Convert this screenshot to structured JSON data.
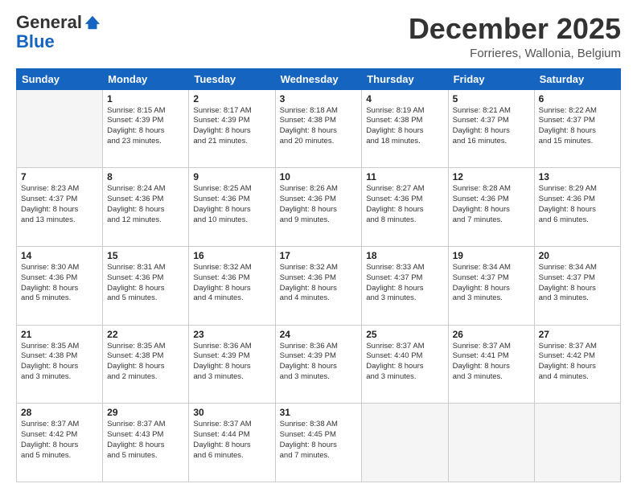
{
  "header": {
    "logo_general": "General",
    "logo_blue": "Blue",
    "month_title": "December 2025",
    "location": "Forrieres, Wallonia, Belgium"
  },
  "calendar": {
    "days_of_week": [
      "Sunday",
      "Monday",
      "Tuesday",
      "Wednesday",
      "Thursday",
      "Friday",
      "Saturday"
    ],
    "weeks": [
      [
        {
          "day": "",
          "info": ""
        },
        {
          "day": "1",
          "info": "Sunrise: 8:15 AM\nSunset: 4:39 PM\nDaylight: 8 hours\nand 23 minutes."
        },
        {
          "day": "2",
          "info": "Sunrise: 8:17 AM\nSunset: 4:39 PM\nDaylight: 8 hours\nand 21 minutes."
        },
        {
          "day": "3",
          "info": "Sunrise: 8:18 AM\nSunset: 4:38 PM\nDaylight: 8 hours\nand 20 minutes."
        },
        {
          "day": "4",
          "info": "Sunrise: 8:19 AM\nSunset: 4:38 PM\nDaylight: 8 hours\nand 18 minutes."
        },
        {
          "day": "5",
          "info": "Sunrise: 8:21 AM\nSunset: 4:37 PM\nDaylight: 8 hours\nand 16 minutes."
        },
        {
          "day": "6",
          "info": "Sunrise: 8:22 AM\nSunset: 4:37 PM\nDaylight: 8 hours\nand 15 minutes."
        }
      ],
      [
        {
          "day": "7",
          "info": "Sunrise: 8:23 AM\nSunset: 4:37 PM\nDaylight: 8 hours\nand 13 minutes."
        },
        {
          "day": "8",
          "info": "Sunrise: 8:24 AM\nSunset: 4:36 PM\nDaylight: 8 hours\nand 12 minutes."
        },
        {
          "day": "9",
          "info": "Sunrise: 8:25 AM\nSunset: 4:36 PM\nDaylight: 8 hours\nand 10 minutes."
        },
        {
          "day": "10",
          "info": "Sunrise: 8:26 AM\nSunset: 4:36 PM\nDaylight: 8 hours\nand 9 minutes."
        },
        {
          "day": "11",
          "info": "Sunrise: 8:27 AM\nSunset: 4:36 PM\nDaylight: 8 hours\nand 8 minutes."
        },
        {
          "day": "12",
          "info": "Sunrise: 8:28 AM\nSunset: 4:36 PM\nDaylight: 8 hours\nand 7 minutes."
        },
        {
          "day": "13",
          "info": "Sunrise: 8:29 AM\nSunset: 4:36 PM\nDaylight: 8 hours\nand 6 minutes."
        }
      ],
      [
        {
          "day": "14",
          "info": "Sunrise: 8:30 AM\nSunset: 4:36 PM\nDaylight: 8 hours\nand 5 minutes."
        },
        {
          "day": "15",
          "info": "Sunrise: 8:31 AM\nSunset: 4:36 PM\nDaylight: 8 hours\nand 5 minutes."
        },
        {
          "day": "16",
          "info": "Sunrise: 8:32 AM\nSunset: 4:36 PM\nDaylight: 8 hours\nand 4 minutes."
        },
        {
          "day": "17",
          "info": "Sunrise: 8:32 AM\nSunset: 4:36 PM\nDaylight: 8 hours\nand 4 minutes."
        },
        {
          "day": "18",
          "info": "Sunrise: 8:33 AM\nSunset: 4:37 PM\nDaylight: 8 hours\nand 3 minutes."
        },
        {
          "day": "19",
          "info": "Sunrise: 8:34 AM\nSunset: 4:37 PM\nDaylight: 8 hours\nand 3 minutes."
        },
        {
          "day": "20",
          "info": "Sunrise: 8:34 AM\nSunset: 4:37 PM\nDaylight: 8 hours\nand 3 minutes."
        }
      ],
      [
        {
          "day": "21",
          "info": "Sunrise: 8:35 AM\nSunset: 4:38 PM\nDaylight: 8 hours\nand 3 minutes."
        },
        {
          "day": "22",
          "info": "Sunrise: 8:35 AM\nSunset: 4:38 PM\nDaylight: 8 hours\nand 2 minutes."
        },
        {
          "day": "23",
          "info": "Sunrise: 8:36 AM\nSunset: 4:39 PM\nDaylight: 8 hours\nand 3 minutes."
        },
        {
          "day": "24",
          "info": "Sunrise: 8:36 AM\nSunset: 4:39 PM\nDaylight: 8 hours\nand 3 minutes."
        },
        {
          "day": "25",
          "info": "Sunrise: 8:37 AM\nSunset: 4:40 PM\nDaylight: 8 hours\nand 3 minutes."
        },
        {
          "day": "26",
          "info": "Sunrise: 8:37 AM\nSunset: 4:41 PM\nDaylight: 8 hours\nand 3 minutes."
        },
        {
          "day": "27",
          "info": "Sunrise: 8:37 AM\nSunset: 4:42 PM\nDaylight: 8 hours\nand 4 minutes."
        }
      ],
      [
        {
          "day": "28",
          "info": "Sunrise: 8:37 AM\nSunset: 4:42 PM\nDaylight: 8 hours\nand 5 minutes."
        },
        {
          "day": "29",
          "info": "Sunrise: 8:37 AM\nSunset: 4:43 PM\nDaylight: 8 hours\nand 5 minutes."
        },
        {
          "day": "30",
          "info": "Sunrise: 8:37 AM\nSunset: 4:44 PM\nDaylight: 8 hours\nand 6 minutes."
        },
        {
          "day": "31",
          "info": "Sunrise: 8:38 AM\nSunset: 4:45 PM\nDaylight: 8 hours\nand 7 minutes."
        },
        {
          "day": "",
          "info": ""
        },
        {
          "day": "",
          "info": ""
        },
        {
          "day": "",
          "info": ""
        }
      ]
    ]
  }
}
